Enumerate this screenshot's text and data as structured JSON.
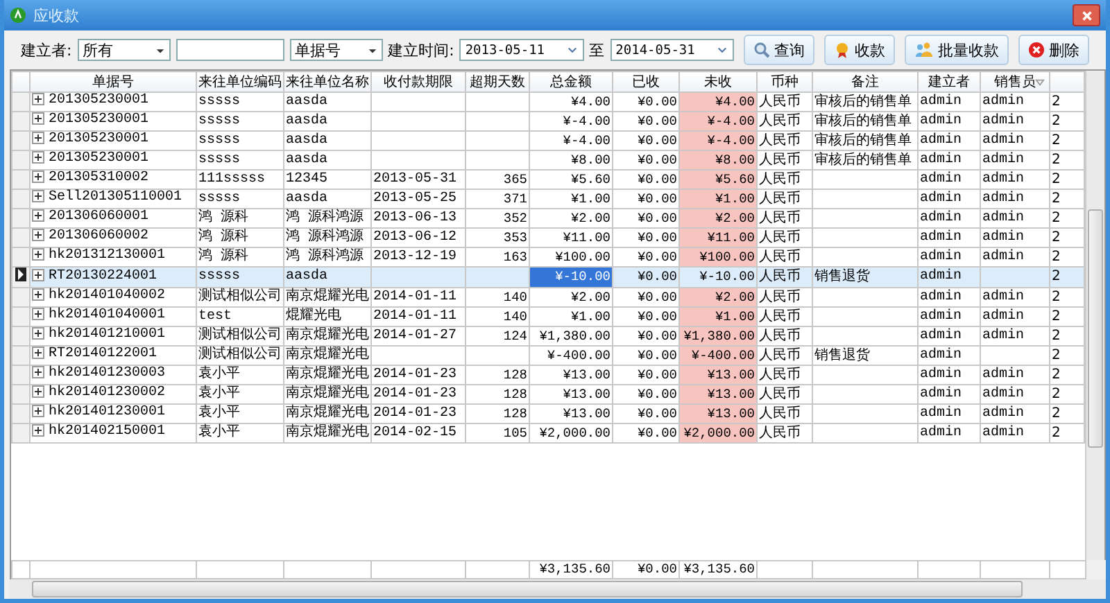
{
  "window": {
    "title": "应收款"
  },
  "filters": {
    "creator_label": "建立者:",
    "creator_value": "所有",
    "field_value": "单据号",
    "date_label": "建立时间:",
    "date_from": "2013-05-11",
    "date_sep": "至",
    "date_to": "2014-05-31"
  },
  "buttons": [
    {
      "kind": "search",
      "label": "查询"
    },
    {
      "kind": "receive",
      "label": "收款"
    },
    {
      "kind": "batch",
      "label": "批量收款"
    },
    {
      "kind": "delete",
      "label": "删除"
    }
  ],
  "table": {
    "columns": [
      "单据号",
      "来往单位编码",
      "来往单位名称",
      "收付款期限",
      "超期天数",
      "总金额",
      "已收",
      "未收",
      "币种",
      "备注",
      "建立者",
      "销售员"
    ],
    "rows": [
      {
        "selected": false,
        "doc_no": "201305230001",
        "code": "sssss",
        "name": "aasda",
        "total": "¥4.00",
        "received": "¥0.00",
        "unpaid": "¥4.00",
        "currency": "人民币",
        "note": "审核后的销售单",
        "creator": "admin",
        "seller": "admin",
        "column_13": "2"
      },
      {
        "selected": false,
        "doc_no": "201305230001",
        "code": "sssss",
        "name": "aasda",
        "total": "¥-4.00",
        "received": "¥0.00",
        "unpaid": "¥-4.00",
        "currency": "人民币",
        "note": "审核后的销售单",
        "creator": "admin",
        "seller": "admin",
        "column_13": "2"
      },
      {
        "selected": false,
        "doc_no": "201305230001",
        "code": "sssss",
        "name": "aasda",
        "total": "¥-4.00",
        "received": "¥0.00",
        "unpaid": "¥-4.00",
        "currency": "人民币",
        "note": "审核后的销售单",
        "creator": "admin",
        "seller": "admin",
        "column_13": "2"
      },
      {
        "selected": false,
        "doc_no": "201305230001",
        "code": "sssss",
        "name": "aasda",
        "total": "¥8.00",
        "received": "¥0.00",
        "unpaid": "¥8.00",
        "currency": "人民币",
        "note": "审核后的销售单",
        "creator": "admin",
        "seller": "admin",
        "column_13": "2"
      },
      {
        "selected": false,
        "doc_no": "201305310002",
        "code": "111sssss",
        "name": "12345",
        "due": "2013-05-31",
        "overdue": "365",
        "total": "¥5.60",
        "received": "¥0.00",
        "unpaid": "¥5.60",
        "currency": "人民币",
        "creator": "admin",
        "seller": "admin",
        "column_13": "2"
      },
      {
        "selected": false,
        "doc_no": "Sell201305110001",
        "code": "sssss",
        "name": "aasda",
        "due": "2013-05-25",
        "overdue": "371",
        "total": "¥1.00",
        "received": "¥0.00",
        "unpaid": "¥1.00",
        "currency": "人民币",
        "creator": "admin",
        "seller": "admin",
        "column_13": "2"
      },
      {
        "selected": false,
        "doc_no": "201306060001",
        "code": "鸿 源科",
        "name": "鸿 源科鸿源",
        "due": "2013-06-13",
        "overdue": "352",
        "total": "¥2.00",
        "received": "¥0.00",
        "unpaid": "¥2.00",
        "currency": "人民币",
        "creator": "admin",
        "seller": "admin",
        "column_13": "2"
      },
      {
        "selected": false,
        "doc_no": "201306060002",
        "code": "鸿 源科",
        "name": "鸿 源科鸿源",
        "due": "2013-06-12",
        "overdue": "353",
        "total": "¥11.00",
        "received": "¥0.00",
        "unpaid": "¥11.00",
        "currency": "人民币",
        "creator": "admin",
        "seller": "admin",
        "column_13": "2"
      },
      {
        "selected": false,
        "doc_no": "hk201312130001",
        "code": "鸿 源科",
        "name": "鸿 源科鸿源",
        "due": "2013-12-19",
        "overdue": "163",
        "total": "¥100.00",
        "received": "¥0.00",
        "unpaid": "¥100.00",
        "currency": "人民币",
        "creator": "admin",
        "seller": "admin",
        "column_13": "2"
      },
      {
        "selected": true,
        "doc_no": "RT20130224001",
        "code": "sssss",
        "name": "aasda",
        "total": "¥-10.00",
        "received": "¥0.00",
        "unpaid": "¥-10.00",
        "currency": "人民币",
        "note": "销售退货",
        "creator": "admin",
        "column_13": "2"
      },
      {
        "selected": false,
        "doc_no": "hk201401040002",
        "code": "测试相似公司",
        "name": "南京焜耀光电",
        "due": "2014-01-11",
        "overdue": "140",
        "total": "¥2.00",
        "received": "¥0.00",
        "unpaid": "¥2.00",
        "currency": "人民币",
        "creator": "admin",
        "seller": "admin",
        "column_13": "2"
      },
      {
        "selected": false,
        "doc_no": "hk201401040001",
        "code": "test",
        "name": "焜耀光电",
        "due": "2014-01-11",
        "overdue": "140",
        "total": "¥1.00",
        "received": "¥0.00",
        "unpaid": "¥1.00",
        "currency": "人民币",
        "creator": "admin",
        "seller": "admin",
        "column_13": "2"
      },
      {
        "selected": false,
        "doc_no": "hk201401210001",
        "code": "测试相似公司",
        "name": "南京焜耀光电",
        "due": "2014-01-27",
        "overdue": "124",
        "total": "¥1,380.00",
        "received": "¥0.00",
        "unpaid": "¥1,380.00",
        "currency": "人民币",
        "creator": "admin",
        "seller": "admin",
        "column_13": "2"
      },
      {
        "selected": false,
        "doc_no": "RT20140122001",
        "code": "测试相似公司",
        "name": "南京焜耀光电",
        "total": "¥-400.00",
        "received": "¥0.00",
        "unpaid": "¥-400.00",
        "currency": "人民币",
        "note": "销售退货",
        "creator": "admin",
        "column_13": "2"
      },
      {
        "selected": false,
        "doc_no": "hk201401230003",
        "code": "袁小平",
        "name": "南京焜耀光电",
        "due": "2014-01-23",
        "overdue": "128",
        "total": "¥13.00",
        "received": "¥0.00",
        "unpaid": "¥13.00",
        "currency": "人民币",
        "creator": "admin",
        "seller": "admin",
        "column_13": "2"
      },
      {
        "selected": false,
        "doc_no": "hk201401230002",
        "code": "袁小平",
        "name": "南京焜耀光电",
        "due": "2014-01-23",
        "overdue": "128",
        "total": "¥13.00",
        "received": "¥0.00",
        "unpaid": "¥13.00",
        "currency": "人民币",
        "creator": "admin",
        "seller": "admin",
        "column_13": "2"
      },
      {
        "selected": false,
        "doc_no": "hk201401230001",
        "code": "袁小平",
        "name": "南京焜耀光电",
        "due": "2014-01-23",
        "overdue": "128",
        "total": "¥13.00",
        "received": "¥0.00",
        "unpaid": "¥13.00",
        "currency": "人民币",
        "creator": "admin",
        "seller": "admin",
        "column_13": "2"
      },
      {
        "selected": false,
        "doc_no": "hk201402150001",
        "code": "袁小平",
        "name": "南京焜耀光电",
        "due": "2014-02-15",
        "overdue": "105",
        "total": "¥2,000.00",
        "received": "¥0.00",
        "unpaid": "¥2,000.00",
        "currency": "人民币",
        "creator": "admin",
        "seller": "admin",
        "column_13": "2"
      }
    ],
    "totals": {
      "total": "¥3,135.60",
      "received": "¥0.00",
      "unpaid": "¥3,135.60"
    }
  }
}
